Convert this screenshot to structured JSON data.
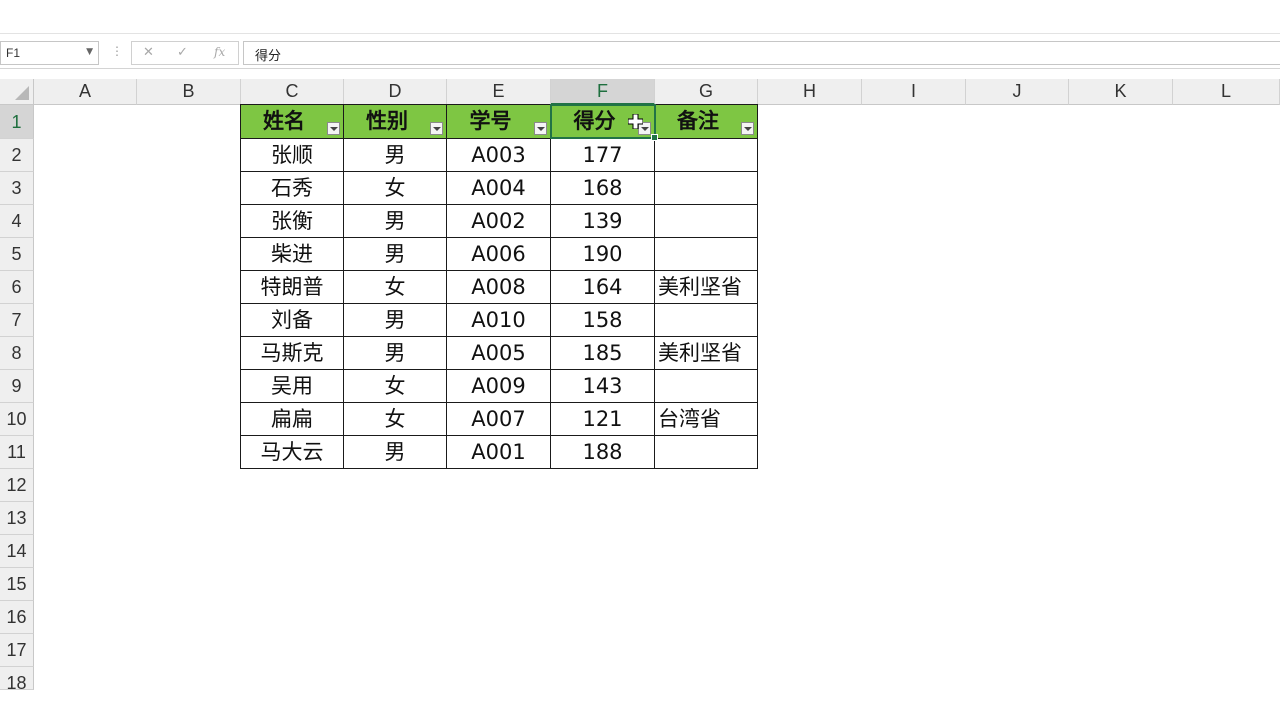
{
  "name_box": {
    "value": "F1"
  },
  "formula_bar": {
    "cancel_glyph": "✕",
    "enter_glyph": "✓",
    "fx_glyph": "fx",
    "value": "得分"
  },
  "columns": [
    "A",
    "B",
    "C",
    "D",
    "E",
    "F",
    "G",
    "H",
    "I",
    "J",
    "K",
    "L"
  ],
  "rows": [
    "1",
    "2",
    "3",
    "4",
    "5",
    "6",
    "7",
    "8",
    "9",
    "10",
    "11",
    "12",
    "13",
    "14",
    "15",
    "16",
    "17",
    "18"
  ],
  "selected": {
    "column": "F",
    "row": "1"
  },
  "table": {
    "headers": [
      "姓名",
      "性别",
      "学号",
      "得分",
      "备注"
    ],
    "rows": [
      [
        "张顺",
        "男",
        "A003",
        "177",
        ""
      ],
      [
        "石秀",
        "女",
        "A004",
        "168",
        ""
      ],
      [
        "张衡",
        "男",
        "A002",
        "139",
        ""
      ],
      [
        "柴进",
        "男",
        "A006",
        "190",
        ""
      ],
      [
        "特朗普",
        "女",
        "A008",
        "164",
        "美利坚省"
      ],
      [
        "刘备",
        "男",
        "A010",
        "158",
        ""
      ],
      [
        "马斯克",
        "男",
        "A005",
        "185",
        "美利坚省"
      ],
      [
        "吴用",
        "女",
        "A009",
        "143",
        ""
      ],
      [
        "扁扁",
        "女",
        "A007",
        "121",
        "台湾省"
      ],
      [
        "马大云",
        "男",
        "A001",
        "188",
        ""
      ]
    ]
  },
  "colors": {
    "header_fill": "#7ec643",
    "selection": "#217346"
  }
}
